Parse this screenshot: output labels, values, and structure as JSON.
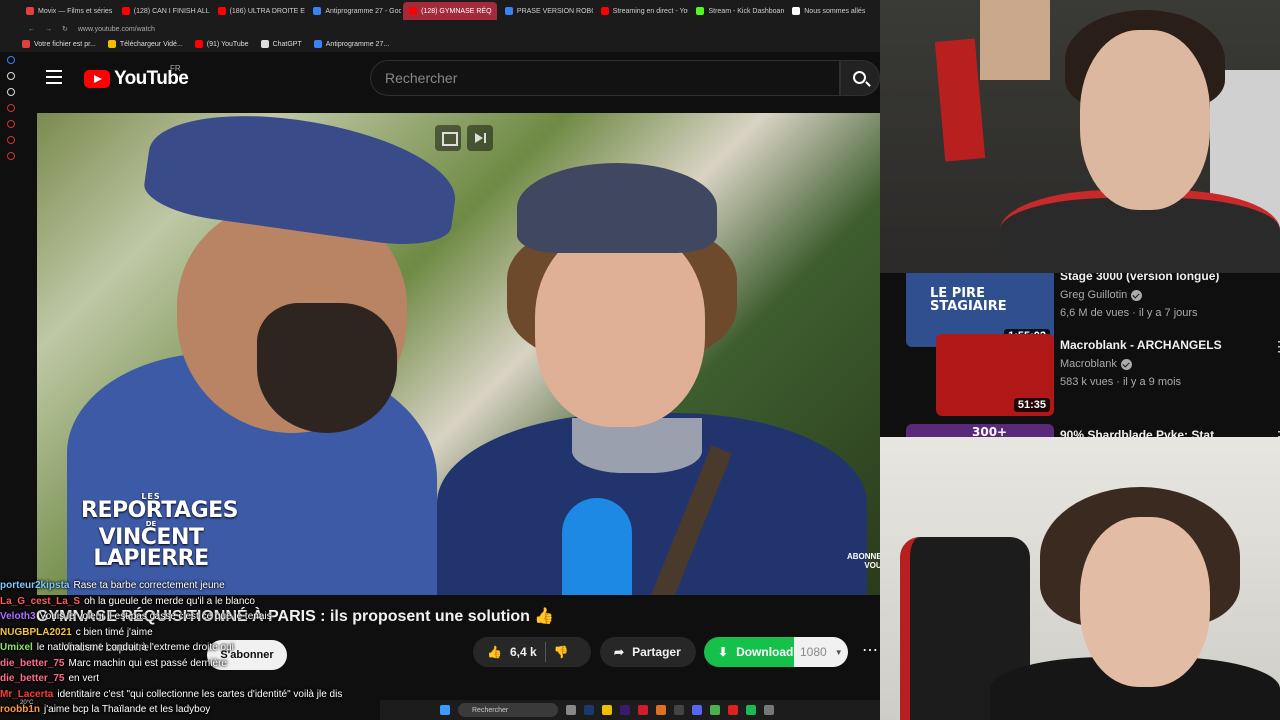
{
  "browser": {
    "tabs": [
      {
        "label": "Movix — Films et séries e",
        "color": "#e04040"
      },
      {
        "label": "(128) CAN I FINISH ALL TI",
        "color": "#ff0000"
      },
      {
        "label": "(186) ULTRA DROITE ET I",
        "color": "#ff0000"
      },
      {
        "label": "Antiprogramme 27 - Goog",
        "color": "#3b82f6"
      },
      {
        "label": "(128) GYMNASE RÉQ",
        "color": "#ff0000",
        "active": true
      },
      {
        "label": "PRASE VERSION ROBOPI",
        "color": "#3b82f6"
      },
      {
        "label": "Streaming en direct - YouT",
        "color": "#ff0000"
      },
      {
        "label": "Stream - Kick Dashboard",
        "color": "#53fc18"
      },
      {
        "label": "Nous sommes allés",
        "color": "#ffffff"
      }
    ],
    "url": "www.youtube.com/watch",
    "bookmarks": [
      {
        "label": "Votre fichier est pr...",
        "color": "#e04040"
      },
      {
        "label": "Téléchargeur Vidé...",
        "color": "#f0c000"
      },
      {
        "label": "(91) YouTube",
        "color": "#ff0000"
      },
      {
        "label": "ChatGPT",
        "color": "#dddddd"
      },
      {
        "label": "Antiprogramme 27...",
        "color": "#3b82f6"
      }
    ]
  },
  "youtube": {
    "logo_text": "YouTube",
    "country": "FR",
    "search_placeholder": "Rechercher"
  },
  "video": {
    "brand_small": "LES",
    "brand_line1": "REPORTAGES",
    "brand_mid": "DE",
    "brand_line2": "VINCENT LAPIERRE",
    "watermark_line1": "ABONNE",
    "watermark_line2": "VOU",
    "title": "GYMNASE RÉQUISITIONNÉ À PARIS : ils proposent une solution 👍",
    "channel": "Vincent Lapierre",
    "subscribe_label": "S'abonner",
    "like_count": "6,4 k",
    "share_label": "Partager",
    "download_label": "Download",
    "quality": "1080"
  },
  "chat": [
    {
      "user": "porteur2kipsta",
      "color": "#7ec8ff",
      "msg": "Rase ta barbe correctement jeune"
    },
    {
      "user": "La_G_cest_La_S",
      "color": "#ff5a5a",
      "msg": "oh la gueule de merde qu'il a le blanco"
    },
    {
      "user": "Veloth3",
      "color": "#b06cff",
      "msg": "Vouis le voleur il est pas casse c'est ce que je tenais"
    },
    {
      "user": "NUGBPLA2021",
      "color": "#f5c242",
      "msg": "c bien timé j'aime"
    },
    {
      "user": "Umixel",
      "color": "#8de36a",
      "msg": "le nationalisme conduit à l'extreme droite oui"
    },
    {
      "user": "die_better_75",
      "color": "#ff6b8a",
      "msg": "Marc machin qui est passé dernière"
    },
    {
      "user": "die_better_75",
      "color": "#ff6b8a",
      "msg": "en vert"
    },
    {
      "user": "Mr_Lacerta",
      "color": "#ff3b3b",
      "msg": "identitaire c'est \"qui collectionne les cartes d'identité\" voilà jle dis"
    },
    {
      "user": "roobb1n",
      "color": "#ff9a3c",
      "msg": "j'aime bcp la Thaïlande et les ladyboy"
    }
  ],
  "taskbar": {
    "search_placeholder": "Rechercher",
    "temperature": "20°C"
  },
  "recommendations": [
    {
      "title": "Stage 3000 (version longue)",
      "channel": "Greg Guillotin",
      "meta": "6,6 M de vues · il y a 7 jours",
      "duration": "1:55:02",
      "thumb_text": "LE PIRE STAGIAIRE",
      "thumb_color": "#2f4f8f"
    },
    {
      "title": "Macroblank - ARCHANGELS",
      "channel": "Macroblank",
      "meta": "583 k vues · il y a 9 mois",
      "duration": "51:35",
      "thumb_text": "",
      "thumb_color": "#b01818"
    },
    {
      "title": "90% Shardblade Pyke: Stat",
      "channel": "",
      "meta": "",
      "duration": "",
      "thumb_text": "300+",
      "thumb_color": "#5a2a7a"
    }
  ]
}
